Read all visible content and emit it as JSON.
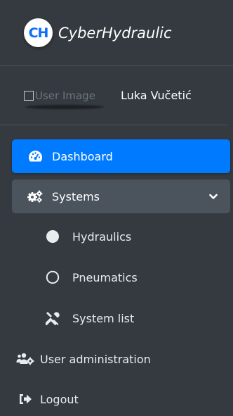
{
  "brand": {
    "logo_text": "CH",
    "name": "CyberHydraulic",
    "logo_color": "#0d6efd"
  },
  "user": {
    "image_alt": "User Image",
    "name": "Luka Vučetić"
  },
  "nav": {
    "dashboard": {
      "label": "Dashboard",
      "icon": "tachometer-icon",
      "active": true
    },
    "systems": {
      "label": "Systems",
      "icon": "cogs-icon",
      "expanded": true,
      "children": [
        {
          "label": "Hydraulics",
          "icon": "filled-circle-icon"
        },
        {
          "label": "Pneumatics",
          "icon": "empty-circle-icon"
        },
        {
          "label": "System list",
          "icon": "tools-icon"
        }
      ]
    },
    "user_admin": {
      "label": "User administration",
      "icon": "users-cog-icon"
    },
    "logout": {
      "label": "Logout",
      "icon": "sign-out-icon"
    }
  },
  "colors": {
    "sidebar_bg": "#343a40",
    "active_bg": "#007bff",
    "open_bg": "#4b545c"
  }
}
